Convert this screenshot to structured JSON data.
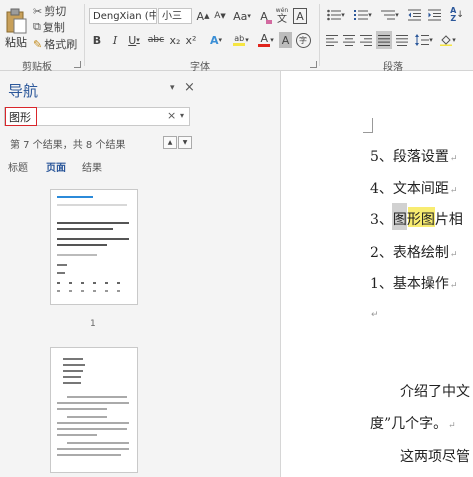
{
  "ribbon": {
    "clipboard": {
      "paste_label": "粘贴",
      "cut_label": "剪切",
      "copy_label": "复制",
      "format_painter_label": "格式刷",
      "group_label": "剪贴板"
    },
    "font": {
      "font_name": "DengXian (中",
      "font_size": "小三",
      "group_label": "字体",
      "bold": "B",
      "italic": "I",
      "underline": "U",
      "strike": "abc",
      "subscript": "x₂",
      "superscript": "x²",
      "grow": "A",
      "shrink": "A",
      "case": "Aa",
      "clear": "A",
      "phonetic": "wén",
      "border_char": "A",
      "effect": "A",
      "highlight": "ab",
      "font_color": "A",
      "shade_char": "A",
      "circle_char": "字"
    },
    "paragraph": {
      "group_label": "段落"
    }
  },
  "nav": {
    "title": "导航",
    "search_value": "图形",
    "result_count": "第 7 个结果，共 8 个结果",
    "tabs": [
      "标题",
      "页面",
      "结果"
    ],
    "thumbnails": [
      {
        "page_number": "1"
      },
      {
        "page_number": ""
      }
    ]
  },
  "document": {
    "list_items": [
      "5、段落设置",
      "4、文本间距",
      "3、图形图片相",
      "2、表格绘制",
      "1、基本操作"
    ],
    "para_line1": "介绍了中文",
    "para_line2": "度”几个字。",
    "para_line3": "这两项尽管"
  },
  "colors": {
    "accent": "#2b579a",
    "highlight_yellow": "#f6e542",
    "search_border": "#d9262b",
    "font_color_red": "#e0241c"
  }
}
